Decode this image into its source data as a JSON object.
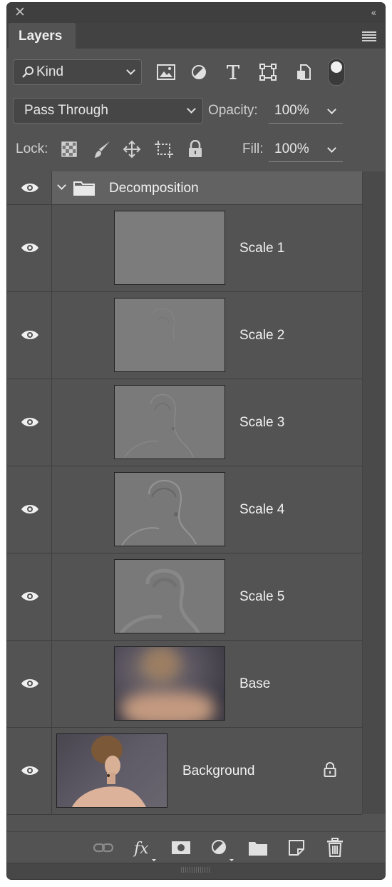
{
  "panel": {
    "tab_title": "Layers",
    "filter_kind_label": "Kind",
    "blend_mode": "Pass Through",
    "opacity_label": "Opacity:",
    "opacity_value": "100%",
    "lock_label": "Lock:",
    "fill_label": "Fill:",
    "fill_value": "100%"
  },
  "group": {
    "name": "Decomposition"
  },
  "layers": [
    {
      "name": "Scale 1"
    },
    {
      "name": "Scale 2"
    },
    {
      "name": "Scale 3"
    },
    {
      "name": "Scale 4"
    },
    {
      "name": "Scale 5"
    },
    {
      "name": "Base"
    },
    {
      "name": "Background"
    }
  ],
  "icons": {
    "colors": {
      "panel": "#535353",
      "row_group": "#626262",
      "text": "#f2f2f2"
    }
  }
}
